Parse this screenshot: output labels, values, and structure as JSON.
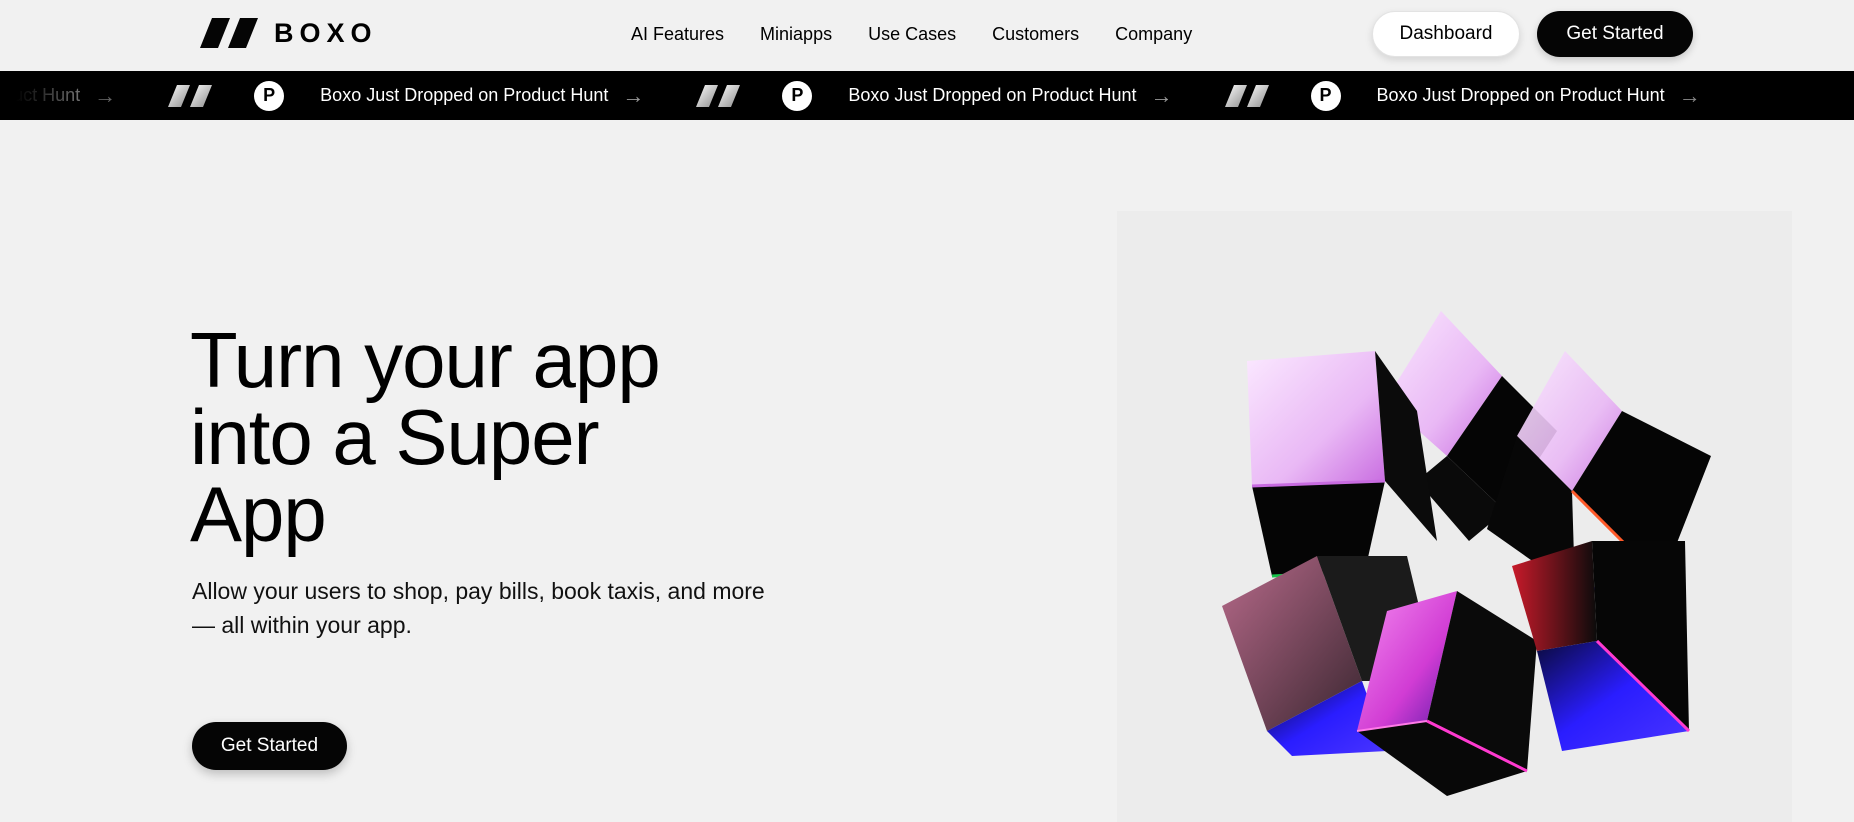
{
  "brand": {
    "name": "BOXO"
  },
  "nav": {
    "links": [
      {
        "label": "AI Features"
      },
      {
        "label": "Miniapps"
      },
      {
        "label": "Use Cases"
      },
      {
        "label": "Customers"
      },
      {
        "label": "Company"
      }
    ],
    "dashboard_label": "Dashboard",
    "get_started_label": "Get Started"
  },
  "ticker": {
    "badge_letter": "P",
    "items": [
      {
        "text": "Boxo Just Dropped on Product Hunt"
      },
      {
        "text": "Boxo Just Dropped on Product Hunt"
      },
      {
        "text": "Boxo Just Dropped on Product Hunt"
      },
      {
        "text": "Boxo Just Dropped on Product Hunt"
      }
    ],
    "arrow_glyph": "→"
  },
  "hero": {
    "title_lines": [
      "Turn your app",
      "into a Super",
      "App"
    ],
    "subtitle": "Allow your users to shop, pay bills, book taxis, and more — all within your app.",
    "cta_label": "Get Started"
  },
  "colors": {
    "background": "#f1f1f1",
    "ticker_bg": "#000000",
    "button_dark": "#050505",
    "accent_magenta": "#e04bd8",
    "accent_blue": "#2a1dff"
  },
  "icons": {
    "logo": "boxo-logo-icon",
    "ticker_logo": "boxo-mark-icon",
    "product_hunt": "product-hunt-icon",
    "arrow": "arrow-right-icon"
  }
}
